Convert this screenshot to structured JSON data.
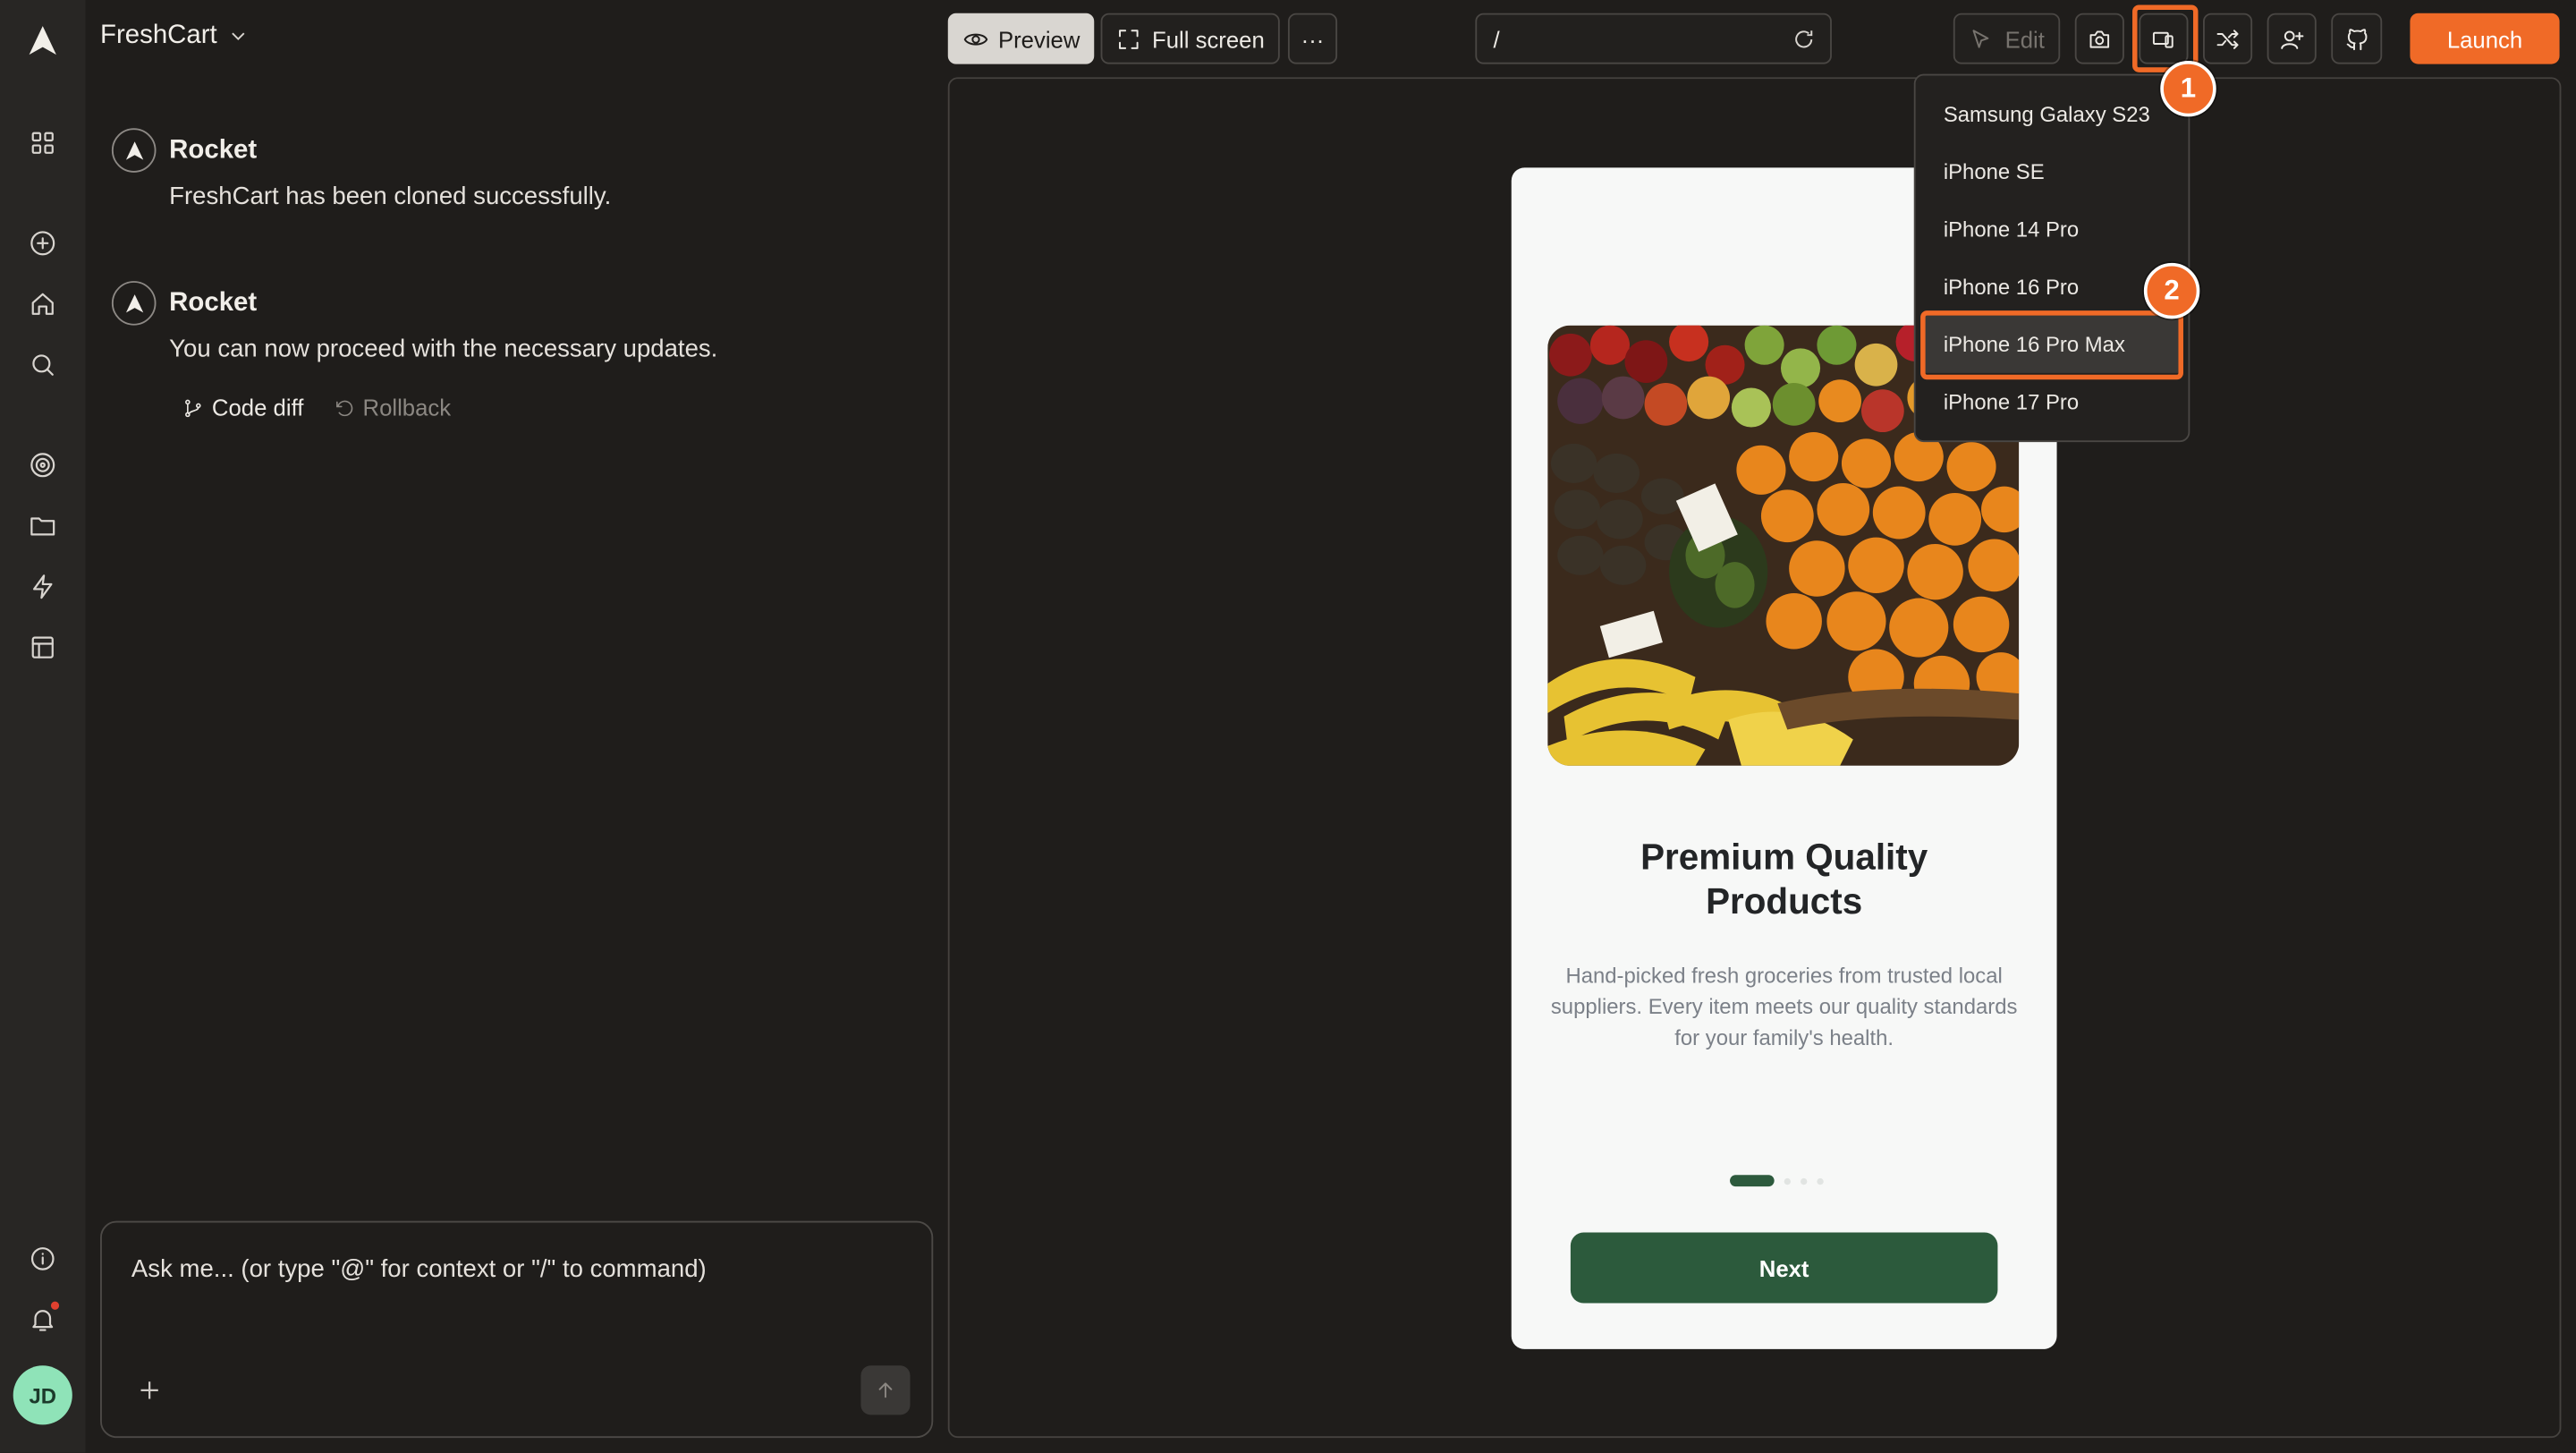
{
  "app": {
    "project_name": "FreshCart"
  },
  "rail": {
    "icons": [
      "logo-icon",
      "dashboard-icon",
      "add-circle-icon",
      "home-icon",
      "search-icon",
      "target-icon",
      "folder-icon",
      "bolt-icon",
      "layout-icon",
      "info-icon",
      "bell-icon"
    ],
    "user_initials": "JD"
  },
  "toolbar": {
    "preview_label": "Preview",
    "fullscreen_label": "Full screen",
    "more_label": "···",
    "url_value": "/",
    "edit_label": "Edit",
    "launch_label": "Launch"
  },
  "chat": {
    "messages": [
      {
        "author": "Rocket",
        "text": "FreshCart has been cloned successfully."
      },
      {
        "author": "Rocket",
        "text": "You can now proceed with the necessary updates."
      }
    ],
    "actions": {
      "code_diff": "Code diff",
      "rollback": "Rollback"
    },
    "composer_placeholder": "Ask me... (or type \"@\" for context or \"/\" to command)"
  },
  "device_menu": {
    "items": [
      "Samsung Galaxy S23",
      "iPhone SE",
      "iPhone 14 Pro",
      "iPhone 16 Pro",
      "iPhone 16 Pro Max",
      "iPhone 17 Pro"
    ],
    "selected": "iPhone 16 Pro Max"
  },
  "annotations": {
    "badge_1": "1",
    "badge_2": "2"
  },
  "phone": {
    "title_line1": "Premium Quality",
    "title_line2": "Products",
    "description": "Hand-picked fresh groceries from trusted local suppliers. Every item meets our quality standards for your family's health.",
    "page_count": 4,
    "current_page": 1,
    "next_label": "Next"
  },
  "colors": {
    "accent": "#f06a27",
    "app_bg": "#1f1d1b",
    "phone_primary": "#2c5a3c"
  }
}
